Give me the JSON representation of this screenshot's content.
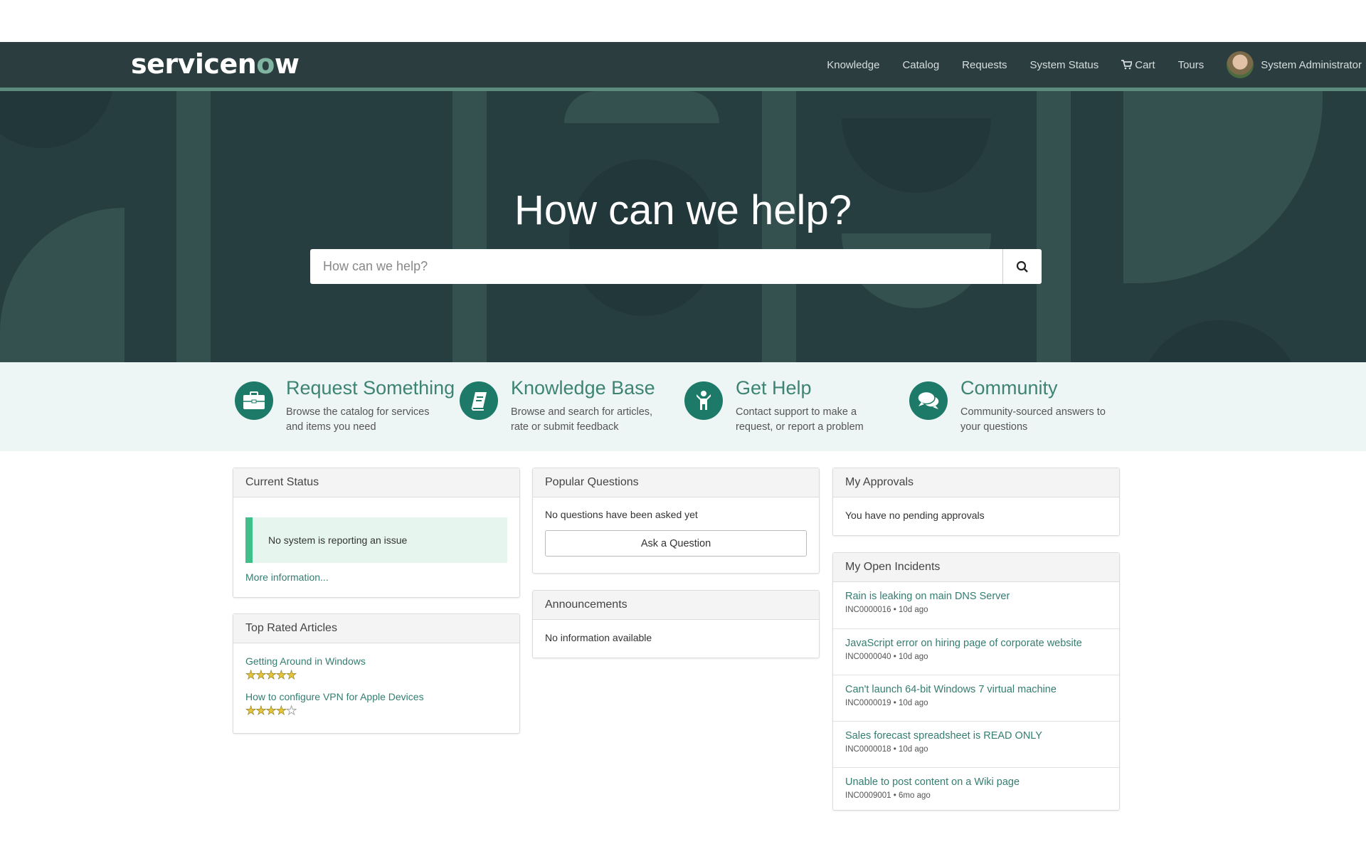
{
  "brand": {
    "logo_prefix": "servicen",
    "logo_o": "o",
    "logo_suffix": "w"
  },
  "nav": {
    "links": [
      "Knowledge",
      "Catalog",
      "Requests",
      "System Status",
      "Cart",
      "Tours"
    ],
    "cart_icon": "cart-icon",
    "user_name": "System Administrator"
  },
  "hero": {
    "title": "How can we help?",
    "search_placeholder": "How can we help?",
    "search_value": "",
    "search_icon": "search-icon"
  },
  "features": [
    {
      "title": "Request Something",
      "desc": "Browse the catalog for services and items you need",
      "icon": "briefcase-icon"
    },
    {
      "title": "Knowledge Base",
      "desc": "Browse and search for articles, rate or submit feedback",
      "icon": "book-icon"
    },
    {
      "title": "Get Help",
      "desc": "Contact support to make a request, or report a problem",
      "icon": "person-help-icon"
    },
    {
      "title": "Community",
      "desc": "Community-sourced answers to your questions",
      "icon": "chat-bubbles-icon"
    }
  ],
  "current_status": {
    "title": "Current Status",
    "message": "No system is reporting an issue",
    "more_link": "More information..."
  },
  "top_rated": {
    "title": "Top Rated Articles",
    "articles": [
      {
        "title": "Getting Around in Windows",
        "rating": 5,
        "max": 5
      },
      {
        "title": "How to configure VPN for Apple Devices",
        "rating": 4,
        "max": 5
      }
    ]
  },
  "popular_questions": {
    "title": "Popular Questions",
    "empty": "No questions have been asked yet",
    "ask_button": "Ask a Question"
  },
  "announcements": {
    "title": "Announcements",
    "empty": "No information available"
  },
  "approvals": {
    "title": "My Approvals",
    "empty": "You have no pending approvals"
  },
  "incidents": {
    "title": "My Open Incidents",
    "items": [
      {
        "title": "Rain is leaking on main DNS Server",
        "number": "INC0000016",
        "age": "10d ago"
      },
      {
        "title": "JavaScript error on hiring page of corporate website",
        "number": "INC0000040",
        "age": "10d ago"
      },
      {
        "title": "Can't launch 64-bit Windows 7 virtual machine",
        "number": "INC0000019",
        "age": "10d ago"
      },
      {
        "title": "Sales forecast spreadsheet is READ ONLY",
        "number": "INC0000018",
        "age": "10d ago"
      },
      {
        "title": "Unable to post content on a Wiki page",
        "number": "INC0009001",
        "age": "6mo ago"
      }
    ]
  },
  "colors": {
    "nav_bg": "#2b3d3e",
    "accent": "#1d7a68",
    "link": "#347d70",
    "status_green": "#41bf8a",
    "star": "#e6c43a"
  }
}
